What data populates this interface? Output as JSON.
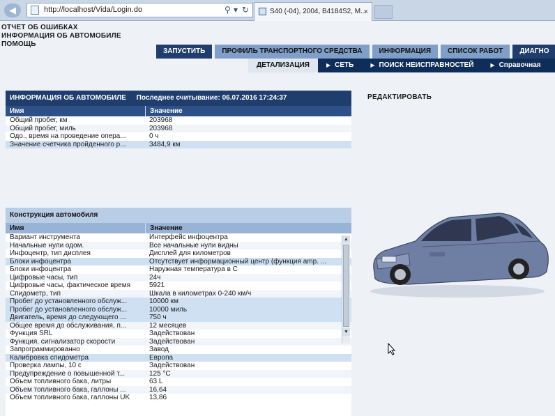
{
  "browser": {
    "address": "http://localhost/Vida/Login.do",
    "tab_title": "S40 (-04), 2004, B4184S2, M...",
    "search_icon": "search-icon",
    "refresh_icon": "refresh-icon",
    "close_tab": "×"
  },
  "app": {
    "title_lines": [
      "ОТЧЕТ ОБ ОШИБКАХ",
      "ИНФОРМАЦИЯ ОБ АВТОМОБИЛЕ",
      "ПОМОЩЬ"
    ]
  },
  "tabs_main": [
    {
      "label": "ЗАПУСТИТЬ"
    },
    {
      "label": "ПРОФИЛЬ ТРАНСПОРТНОГО СРЕДСТВА"
    },
    {
      "label": "ИНФОРМАЦИЯ"
    },
    {
      "label": "СПИСОК РАБОТ"
    },
    {
      "label": "ДИАГНО"
    }
  ],
  "tabs_sub": [
    {
      "label": "ДЕТАЛИЗАЦИЯ"
    },
    {
      "label": "СЕТЬ"
    },
    {
      "label": "ПОИСК НЕИСПРАВНОСТЕЙ"
    },
    {
      "label": "Справочная"
    }
  ],
  "edit_link": "РЕДАКТИРОВАТЬ",
  "vehicle_info": {
    "title": "ИНФОРМАЦИЯ ОБ АВТОМОБИЛЕ",
    "last_read": "Последнее считывание: 06.07.2016 17:24:37",
    "col_name": "Имя",
    "col_value": "Значение",
    "rows": [
      {
        "name": "Общий пробег, км",
        "value": "203968"
      },
      {
        "name": "Общий пробег, миль",
        "value": "203968"
      },
      {
        "name": "Одо., время на проведение опера...",
        "value": "0 ч"
      },
      {
        "name": "Значение счетчика пройденного р...",
        "value": "3484,9 км"
      }
    ]
  },
  "construction": {
    "title": "Конструкция автомобиля",
    "col_name": "Имя",
    "col_value": "Значение",
    "rows": [
      {
        "name": "Вариант инструмента",
        "value": "Интерфейс инфоцентра"
      },
      {
        "name": "Начальные нули одом.",
        "value": "Все начальные нули видны"
      },
      {
        "name": "Инфоцентр, тип дисплея",
        "value": "Дисплей для километров"
      },
      {
        "name": "Блоки инфоцентра",
        "value": "Отсутствует информационный центр (функция amp. ..."
      },
      {
        "name": "Блоки инфоцентра",
        "value": "Наружная температура в C"
      },
      {
        "name": "Цифровые часы, тип",
        "value": "24ч"
      },
      {
        "name": "Цифровые часы, фактическое время",
        "value": "5921"
      },
      {
        "name": "Спидометр, тип",
        "value": "Шкала в километрах 0-240 км/ч"
      },
      {
        "name": "Пробег до установленного обслуж...",
        "value": "10000 км"
      },
      {
        "name": "Пробег до установленного обслуж...",
        "value": "10000 миль"
      },
      {
        "name": "Двигатель, время до следующего ...",
        "value": "750 ч"
      },
      {
        "name": "Общее время до обслуживания, п...",
        "value": "12 месяцев"
      },
      {
        "name": "Функция SRL",
        "value": "Задействован"
      },
      {
        "name": "Функция, сигнализатор скорости",
        "value": "Задействован"
      },
      {
        "name": "Запрограммированно",
        "value": "Завод"
      },
      {
        "name": "Калибровка спидометра",
        "value": "Европа"
      },
      {
        "name": "Проверка лампы, 10 с",
        "value": "Задействован"
      },
      {
        "name": "Предупреждение о повышенной т...",
        "value": "125 °C"
      },
      {
        "name": "Объем топливного бака, литры",
        "value": "63 L"
      },
      {
        "name": "Объем топливного бака, галлоны ...",
        "value": "16,64"
      },
      {
        "name": "Объем топливного бака, галлоны UK",
        "value": "13,86"
      }
    ]
  },
  "colors": {
    "dark_blue": "#1f3e6e",
    "nav_bar": "#0f2d59",
    "highlight_row": "#cfe0f2"
  }
}
